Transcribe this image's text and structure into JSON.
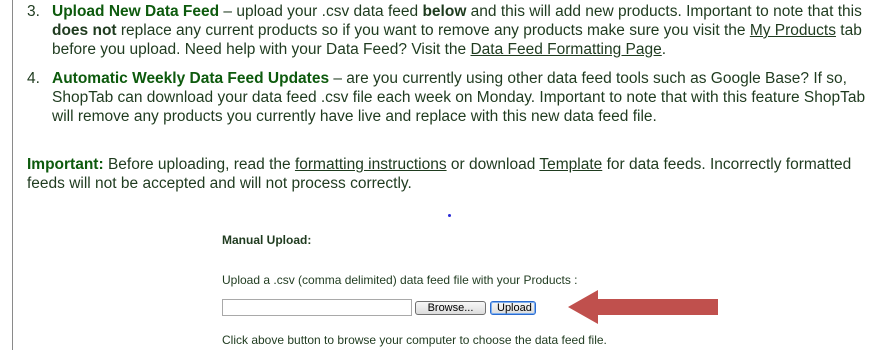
{
  "step3": {
    "number": "3.",
    "title": "Upload New Data Feed",
    "t1": " – upload your .csv data feed ",
    "b1": "below",
    "t2": " and this will add new products. Important to note that this ",
    "b2": "does not",
    "t3": " replace any current products so if you want to remove any products make sure you visit the ",
    "link1": "My Products",
    "t4": " tab before you upload. Need help with your Data Feed? Visit the ",
    "link2": "Data Feed Formatting Page",
    "t5": "."
  },
  "step4": {
    "number": "4.",
    "title": "Automatic Weekly Data Feed Updates",
    "t1": " – are you currently using other data feed tools such as Google Base? If so, ShopTab can download your data feed .csv file each week on Monday. Important to note that with this feature ShopTab will remove any products you currently have live and replace with this new data feed file."
  },
  "important": {
    "label": "Important:",
    "t1": " Before uploading, read the ",
    "link1": "formatting instructions",
    "t2": " or download ",
    "link2": "Template",
    "t3": " for data feeds. Incorrectly formatted feeds will not be accepted and will not process correctly."
  },
  "upload": {
    "title": "Manual Upload:",
    "description": "Upload a .csv (comma delimited) data feed file with your Products :",
    "file_value": "",
    "browse_label": "Browse...",
    "upload_label": "Upload",
    "hint": "Click above button to browse your computer to choose the data feed file."
  },
  "colors": {
    "heading_green": "#0d5a0d",
    "text": "#1f3b1f",
    "arrow_red": "#c0504d"
  },
  "icons": {
    "arrow": "left-pointing-arrow"
  }
}
